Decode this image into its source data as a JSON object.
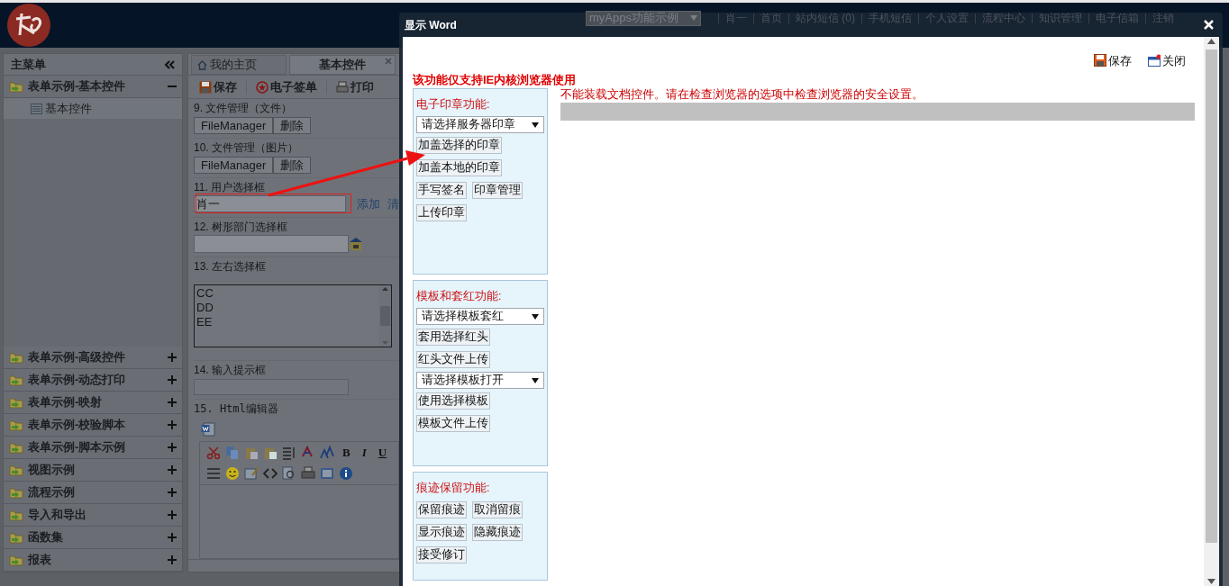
{
  "header": {
    "nav_dropdown": "myApps功能示例",
    "nav_links": [
      "肖一",
      "首页",
      "站内短信 (0)",
      "手机短信",
      "个人设置",
      "流程中心",
      "知识管理",
      "电子信箱",
      "注销"
    ]
  },
  "sidebar": {
    "title": "主菜单",
    "groups": [
      {
        "label": "表单示例-基本控件",
        "expanded": true,
        "children": [
          {
            "label": "基本控件",
            "selected": true
          }
        ]
      },
      {
        "label": "表单示例-高级控件",
        "expanded": false
      },
      {
        "label": "表单示例-动态打印",
        "expanded": false
      },
      {
        "label": "表单示例-映射",
        "expanded": false
      },
      {
        "label": "表单示例-校验脚本",
        "expanded": false
      },
      {
        "label": "表单示例-脚本示例",
        "expanded": false
      },
      {
        "label": "视图示例",
        "expanded": false
      },
      {
        "label": "流程示例",
        "expanded": false
      },
      {
        "label": "导入和导出",
        "expanded": false
      },
      {
        "label": "函数集",
        "expanded": false
      },
      {
        "label": "报表",
        "expanded": false
      }
    ]
  },
  "tabs": [
    {
      "label": "我的主页",
      "selected": false,
      "closable": false
    },
    {
      "label": "基本控件",
      "selected": true,
      "closable": true
    }
  ],
  "toolbar": [
    {
      "label": "保存",
      "kind": "save"
    },
    {
      "label": "电子签单",
      "kind": "sign"
    },
    {
      "label": "打印",
      "kind": "print"
    }
  ],
  "form": {
    "fields": [
      {
        "kind": "file",
        "label": "9. 文件管理（文件）",
        "buttons": [
          "FileManager",
          "删除"
        ]
      },
      {
        "kind": "file",
        "label": "10. 文件管理（图片）",
        "buttons": [
          "FileManager",
          "删除"
        ]
      },
      {
        "kind": "user",
        "label": "11. 用户选择框",
        "value": "肖一",
        "links": [
          "添加",
          "清"
        ]
      },
      {
        "kind": "dept",
        "label": "12. 树形部门选择框"
      },
      {
        "kind": "listbox",
        "label": "13. 左右选择框",
        "options": [
          "CC",
          "DD",
          "EE"
        ]
      },
      {
        "kind": "text",
        "label": "14. 输入提示框"
      },
      {
        "kind": "editor",
        "label": "15. Html编辑器",
        "letter_buttons": [
          "B",
          "I",
          "U"
        ]
      }
    ]
  },
  "dialog": {
    "title": "显示 Word",
    "actions": [
      {
        "label": "保存",
        "kind": "save"
      },
      {
        "label": "关闭",
        "kind": "close"
      }
    ],
    "notice": "该功能仅支持IE内核浏览器使用",
    "error": "不能装载文档控件。请在检查浏览器的选项中检查浏览器的安全设置。",
    "panels": [
      {
        "label": "电子印章功能:",
        "items": [
          {
            "kind": "select",
            "label": "请选择服务器印章"
          },
          {
            "kind": "button",
            "label": "加盖选择的印章"
          },
          {
            "kind": "button",
            "label": "加盖本地的印章"
          },
          {
            "kind": "button",
            "label": "手写签名"
          },
          {
            "kind": "button",
            "label": "印章管理"
          },
          {
            "kind": "button",
            "label": "上传印章"
          }
        ]
      },
      {
        "label": "模板和套红功能:",
        "items": [
          {
            "kind": "select",
            "label": "请选择模板套红"
          },
          {
            "kind": "button",
            "label": "套用选择红头"
          },
          {
            "kind": "button",
            "label": "红头文件上传"
          },
          {
            "kind": "select",
            "label": "请选择模板打开"
          },
          {
            "kind": "button",
            "label": "使用选择模板"
          },
          {
            "kind": "button",
            "label": "模板文件上传"
          }
        ]
      },
      {
        "label": "痕迹保留功能:",
        "items": [
          {
            "kind": "button",
            "label": "保留痕迹"
          },
          {
            "kind": "button",
            "label": "取消留痕"
          },
          {
            "kind": "button",
            "label": "显示痕迹"
          },
          {
            "kind": "button",
            "label": "隐藏痕迹"
          },
          {
            "kind": "button",
            "label": "接受修订"
          }
        ]
      }
    ]
  }
}
